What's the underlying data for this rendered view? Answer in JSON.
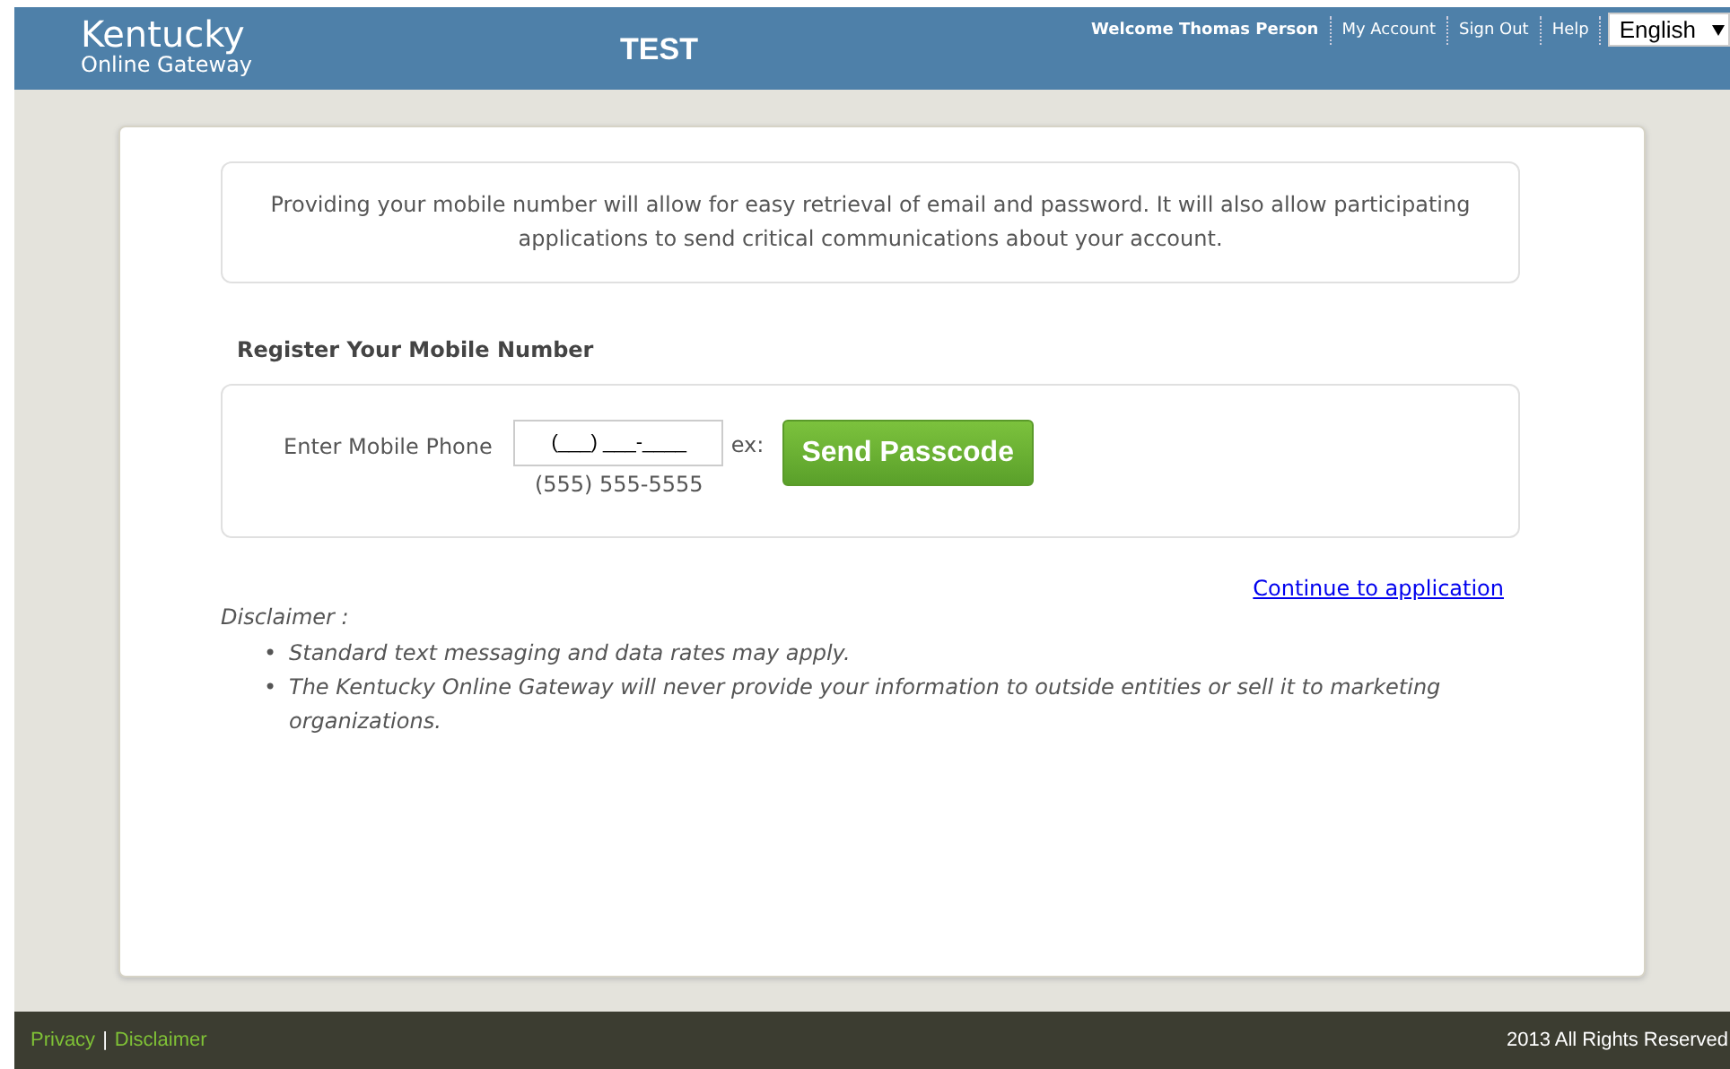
{
  "header": {
    "logo_title": "Kentucky",
    "logo_subtitle": "Online Gateway",
    "environment": "TEST",
    "nav": [
      "Welcome Thomas Person",
      "My Account",
      "Sign Out",
      "Help"
    ],
    "language": "English"
  },
  "notice": "Providing your mobile number will allow for easy retrieval of email and password. It will also allow participating applications to send critical communications about your account.",
  "register": {
    "heading": "Register Your Mobile Number",
    "label": "Enter Mobile Phone",
    "placeholder": "(___) ___-____",
    "example_label": "ex:",
    "example": "(555) 555-5555",
    "button": "Send Passcode"
  },
  "continue_link": "Continue to application",
  "disclaimer": {
    "title": "Disclaimer :",
    "bullet": "•",
    "items": [
      "Standard text messaging and data rates may apply.",
      "The Kentucky Online Gateway will never provide your information to outside entities or sell it to marketing organizations."
    ]
  },
  "footer": {
    "links": [
      "Privacy",
      "Disclaimer"
    ],
    "separator": "|",
    "copyright": "2013 All Rights Reserved"
  }
}
